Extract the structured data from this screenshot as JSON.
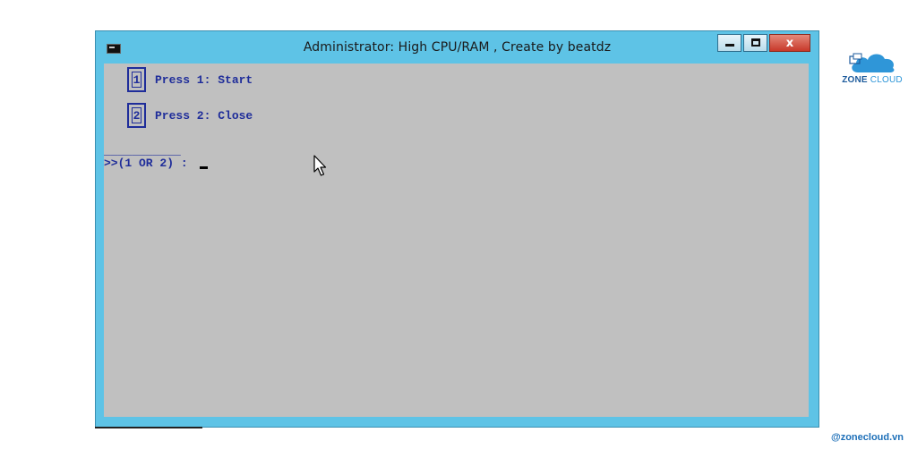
{
  "window": {
    "title": "Administrator:  High CPU/RAM , Create by beatdz",
    "controls": {
      "close_label": "x"
    }
  },
  "console": {
    "options": [
      {
        "key": "1",
        "text": "Press 1: Start"
      },
      {
        "key": "2",
        "text": "Press 2: Close"
      }
    ],
    "separator": "___________",
    "prompt": ">>(1 OR 2) : ",
    "colors": {
      "background": "#c0c0c0",
      "text": "#1f2d9a"
    }
  },
  "branding": {
    "logo_word_1": "ZONE",
    "logo_word_2": "CLOUD",
    "handle": "@zonecloud.vn"
  }
}
